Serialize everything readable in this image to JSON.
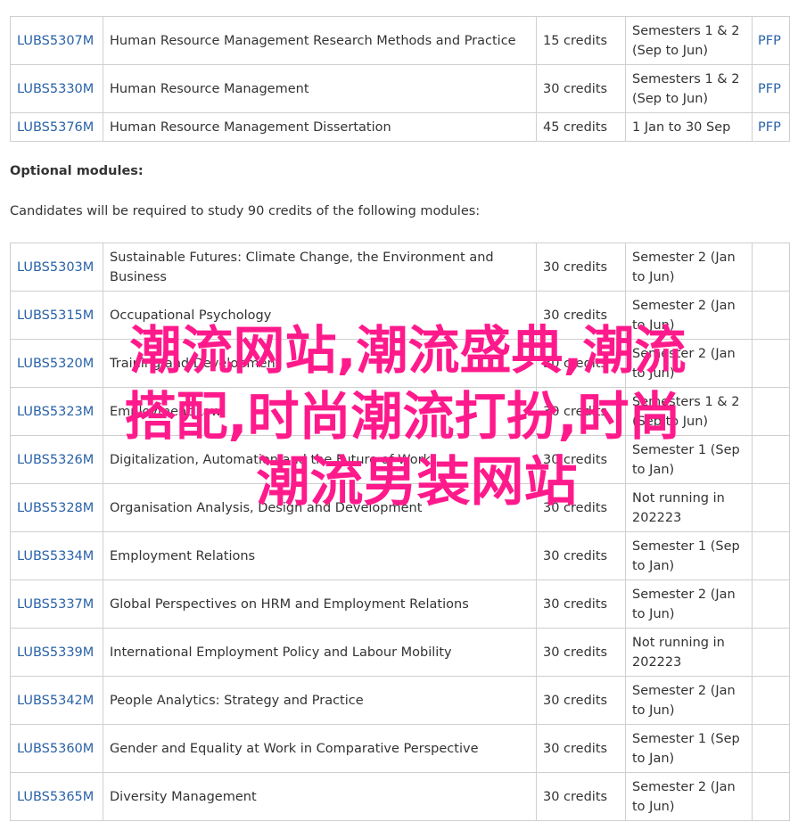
{
  "core_modules": [
    {
      "code": "LUBS5307M",
      "title": "Human Resource Management Research Methods and Practice",
      "credits": "15 credits",
      "semester": "Semesters 1 & 2 (Sep to Jun)",
      "pfp": "PFP"
    },
    {
      "code": "LUBS5330M",
      "title": "Human Resource Management",
      "credits": "30 credits",
      "semester": "Semesters 1 & 2 (Sep to Jun)",
      "pfp": "PFP"
    },
    {
      "code": "LUBS5376M",
      "title": "Human Resource Management Dissertation",
      "credits": "45 credits",
      "semester": "1 Jan to 30 Sep",
      "pfp": "PFP"
    }
  ],
  "optional": {
    "heading": "Optional modules:",
    "intro": "Candidates will be required to study 90 credits of the following modules:"
  },
  "optional_modules": [
    {
      "code": "LUBS5303M",
      "title": "Sustainable Futures: Climate Change, the Environment and Business",
      "credits": "30 credits",
      "semester": "Semester 2 (Jan to Jun)"
    },
    {
      "code": "LUBS5315M",
      "title": "Occupational Psychology",
      "credits": "30 credits",
      "semester": "Semester 2 (Jan to Jun)"
    },
    {
      "code": "LUBS5320M",
      "title": "Training and Development",
      "credits": "30 credits",
      "semester": "Semester 2 (Jan to Jun)"
    },
    {
      "code": "LUBS5323M",
      "title": "Employment Law",
      "credits": "30 credits",
      "semester": "Semesters 1 & 2 (Sep to Jun)"
    },
    {
      "code": "LUBS5326M",
      "title": "Digitalization, Automation and the Future of Work",
      "credits": "30 credits",
      "semester": "Semester 1 (Sep to Jan)"
    },
    {
      "code": "LUBS5328M",
      "title": "Organisation Analysis, Design and Development",
      "credits": "30 credits",
      "semester": "Not running in 202223"
    },
    {
      "code": "LUBS5334M",
      "title": "Employment Relations",
      "credits": "30 credits",
      "semester": "Semester 1 (Sep to Jan)"
    },
    {
      "code": "LUBS5337M",
      "title": "Global Perspectives on HRM and Employment Relations",
      "credits": "30 credits",
      "semester": "Semester 2 (Jan to Jun)"
    },
    {
      "code": "LUBS5339M",
      "title": "International Employment Policy and Labour Mobility",
      "credits": "30 credits",
      "semester": "Not running in 202223"
    },
    {
      "code": "LUBS5342M",
      "title": "People Analytics: Strategy and Practice",
      "credits": "30 credits",
      "semester": "Semester 2 (Jan to Jun)"
    },
    {
      "code": "LUBS5360M",
      "title": "Gender and Equality at Work in Comparative Perspective",
      "credits": "30 credits",
      "semester": "Semester 1 (Sep to Jan)"
    },
    {
      "code": "LUBS5365M",
      "title": "Diversity Management",
      "credits": "30 credits",
      "semester": "Semester 2 (Jan to Jun)"
    }
  ],
  "overlay": {
    "line1": "潮流网站,潮流盛典,潮流",
    "line2": "搭配,时尚潮流打扮,时尚",
    "line3": "潮流男装网站",
    "color": "#ff1a8c"
  }
}
